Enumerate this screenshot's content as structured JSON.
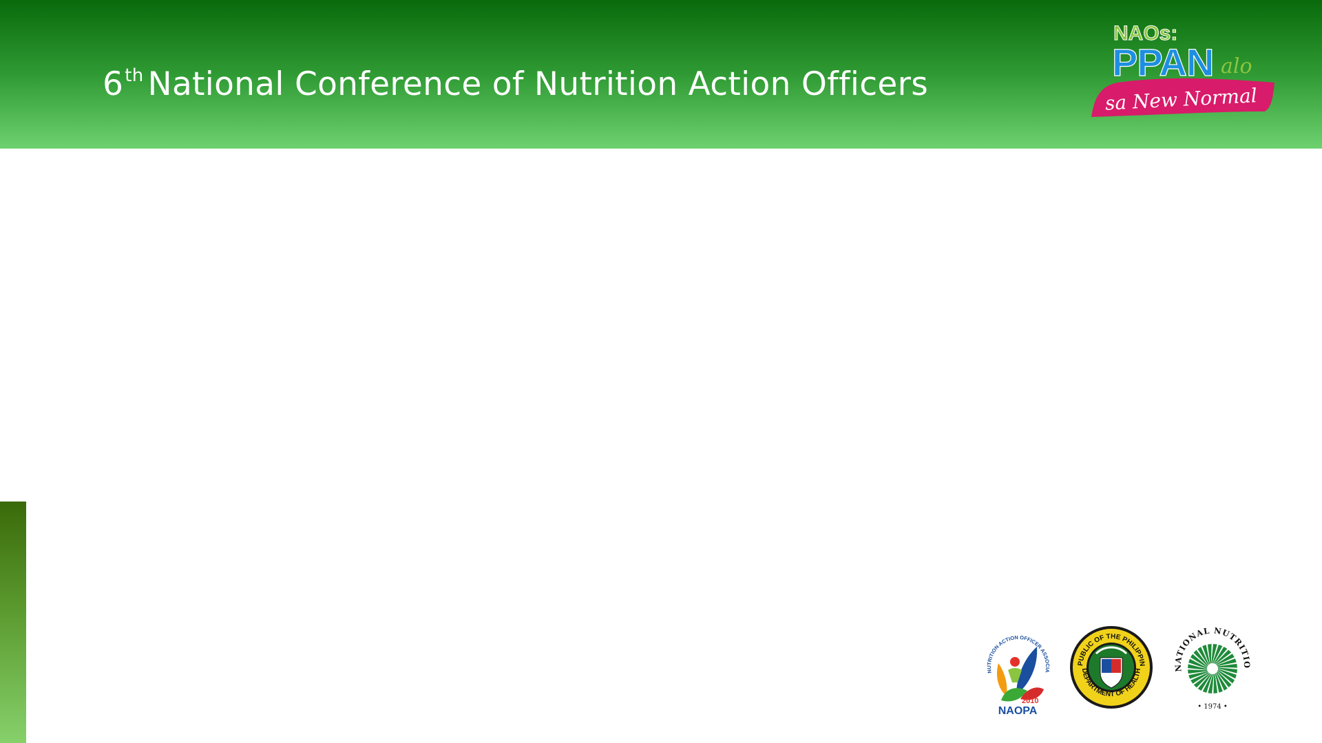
{
  "header": {
    "title_number": "6",
    "title_superscript": "th",
    "title_text": "National Conference of Nutrition Action Officers"
  },
  "brand": {
    "line1": "NAOs:",
    "line2": "PPAN",
    "line2_script": "alo",
    "line3": "sa New Normal"
  },
  "logos": {
    "naopa": {
      "ring_text": "NUTRITION ACTION OFFICER ASSOCIATION OF THE PHILIPPINES, INC.",
      "year": "2010",
      "acronym": "NAOPA"
    },
    "doh": {
      "top_text": "REPUBLIC OF THE PHILIPPINES",
      "bottom_text": "DEPARTMENT OF HEALTH"
    },
    "nnc": {
      "top_text": "NATIONAL NUTRITION COUNCIL",
      "year": "• 1974 •"
    }
  },
  "colors": {
    "header_dark": "#096a0b",
    "header_light": "#6dd16f",
    "brand_blue": "#1e8fe0",
    "brand_green": "#8bc53f",
    "brand_pink": "#d81b6a",
    "side_bar": "#5b9a2e"
  }
}
